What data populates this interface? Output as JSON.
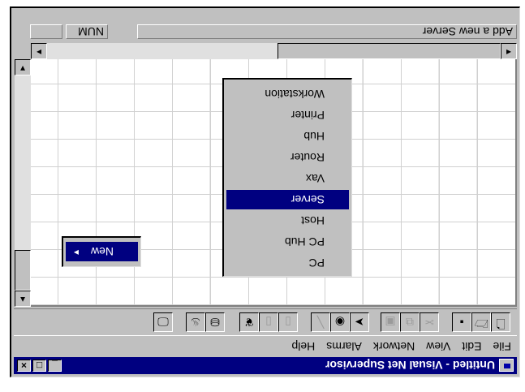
{
  "window": {
    "title": "Untitled - Visual Net Supervisor",
    "controls": {
      "minimize": "_",
      "maximize": "□",
      "close": "×"
    }
  },
  "menubar": {
    "items": [
      "File",
      "Edit",
      "View",
      "Network",
      "Alarms",
      "Help"
    ]
  },
  "toolbar": {
    "buttons": [
      {
        "icon": "new-document-icon",
        "glyph": "🗋"
      },
      {
        "icon": "open-icon",
        "glyph": "🗁"
      },
      {
        "icon": "save-icon",
        "glyph": "▪"
      },
      {
        "icon": "cut-icon",
        "glyph": "✂"
      },
      {
        "icon": "copy-icon",
        "glyph": "⧉"
      },
      {
        "icon": "paste-icon",
        "glyph": "▣"
      },
      {
        "icon": "pointer-icon",
        "glyph": "➤"
      },
      {
        "icon": "zoom-icon",
        "glyph": "◉"
      },
      {
        "icon": "link-icon",
        "glyph": "╲"
      },
      {
        "icon": "device-icon",
        "glyph": "▯"
      },
      {
        "icon": "device2-icon",
        "glyph": "▯"
      },
      {
        "icon": "footprints-icon",
        "glyph": "❦"
      },
      {
        "icon": "network-icon",
        "glyph": "⛁"
      },
      {
        "icon": "alarm-icon",
        "glyph": "♨"
      },
      {
        "icon": "monitor-icon",
        "glyph": "🖵"
      }
    ]
  },
  "context_menu": {
    "new_label": "New",
    "submenu": [
      "PC",
      "PC Hub",
      "Host",
      "Server",
      "Vax",
      "Router",
      "Hub",
      "Printer",
      "Workstation"
    ],
    "selected": "Server"
  },
  "statusbar": {
    "message": "Add a new Server",
    "num": "NUM"
  },
  "scrollbars": {
    "up": "▲",
    "down": "▼",
    "left": "◄",
    "right": "►"
  }
}
